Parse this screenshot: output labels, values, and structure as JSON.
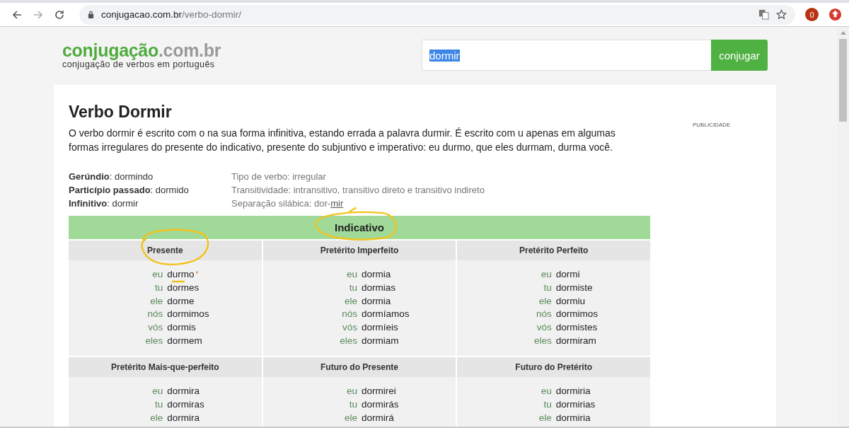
{
  "browser": {
    "url_host": "conjugacao.com.br",
    "url_path": "/verbo-dormir/",
    "badge": "0"
  },
  "header": {
    "logo_main": "conjugação",
    "logo_suffix": ".com.br",
    "tagline": "conjugação de verbos em português",
    "search_value": "dormir",
    "search_button": "conjugar"
  },
  "title": "Verbo Dormir",
  "intro": "O verbo dormir é escrito com o na sua forma infinitiva, estando errada a palavra durmir. É escrito com u apenas em algumas formas irregulares do presente do indicativo, presente do subjuntivo e imperativo: eu durmo, que eles durmam, durma você.",
  "ad_label": "PUBLICIDADE",
  "info_left": [
    "**Gerúndio**: dormindo",
    "**Particípio passado**: dormido",
    "**Infinitivo**: dormir"
  ],
  "info_right": [
    {
      "text": "Tipo de verbo: irregular"
    },
    {
      "text": "Transitividade: intransitivo, transitivo direto e transitivo indireto"
    },
    {
      "text": "Separação silábica: dor-",
      "link": "mir"
    }
  ],
  "mood": {
    "name": "Indicativo",
    "circled": true
  },
  "tense_rows": [
    [
      {
        "name": "Presente",
        "circled": true,
        "forms": [
          {
            "pronoun": "eu",
            "verb": "durmo",
            "underlined": true,
            "mark": "*"
          },
          {
            "pronoun": "tu",
            "verb": "dormes"
          },
          {
            "pronoun": "ele",
            "verb": "dorme"
          },
          {
            "pronoun": "nós",
            "verb": "dormimos"
          },
          {
            "pronoun": "vós",
            "verb": "dormis"
          },
          {
            "pronoun": "eles",
            "verb": "dormem"
          }
        ]
      },
      {
        "name": "Pretérito Imperfeito",
        "circled": false,
        "forms": [
          {
            "pronoun": "eu",
            "verb": "dormia"
          },
          {
            "pronoun": "tu",
            "verb": "dormias"
          },
          {
            "pronoun": "ele",
            "verb": "dormia"
          },
          {
            "pronoun": "nós",
            "verb": "dormíamos"
          },
          {
            "pronoun": "vós",
            "verb": "dormíeis"
          },
          {
            "pronoun": "eles",
            "verb": "dormiam"
          }
        ]
      },
      {
        "name": "Pretérito Perfeito",
        "circled": false,
        "forms": [
          {
            "pronoun": "eu",
            "verb": "dormi"
          },
          {
            "pronoun": "tu",
            "verb": "dormiste"
          },
          {
            "pronoun": "ele",
            "verb": "dormiu"
          },
          {
            "pronoun": "nós",
            "verb": "dormimos"
          },
          {
            "pronoun": "vós",
            "verb": "dormistes"
          },
          {
            "pronoun": "eles",
            "verb": "dormiram"
          }
        ]
      }
    ],
    [
      {
        "name": "Pretérito Mais-que-perfeito",
        "circled": false,
        "forms": [
          {
            "pronoun": "eu",
            "verb": "dormira"
          },
          {
            "pronoun": "tu",
            "verb": "dormiras"
          },
          {
            "pronoun": "ele",
            "verb": "dormira"
          }
        ]
      },
      {
        "name": "Futuro do Presente",
        "circled": false,
        "forms": [
          {
            "pronoun": "eu",
            "verb": "dormirei"
          },
          {
            "pronoun": "tu",
            "verb": "dormirás"
          },
          {
            "pronoun": "ele",
            "verb": "dormirá"
          }
        ]
      },
      {
        "name": "Futuro do Pretérito",
        "circled": false,
        "forms": [
          {
            "pronoun": "eu",
            "verb": "dormiria"
          },
          {
            "pronoun": "tu",
            "verb": "dormirias"
          },
          {
            "pronoun": "ele",
            "verb": "dormiria"
          }
        ]
      }
    ]
  ]
}
